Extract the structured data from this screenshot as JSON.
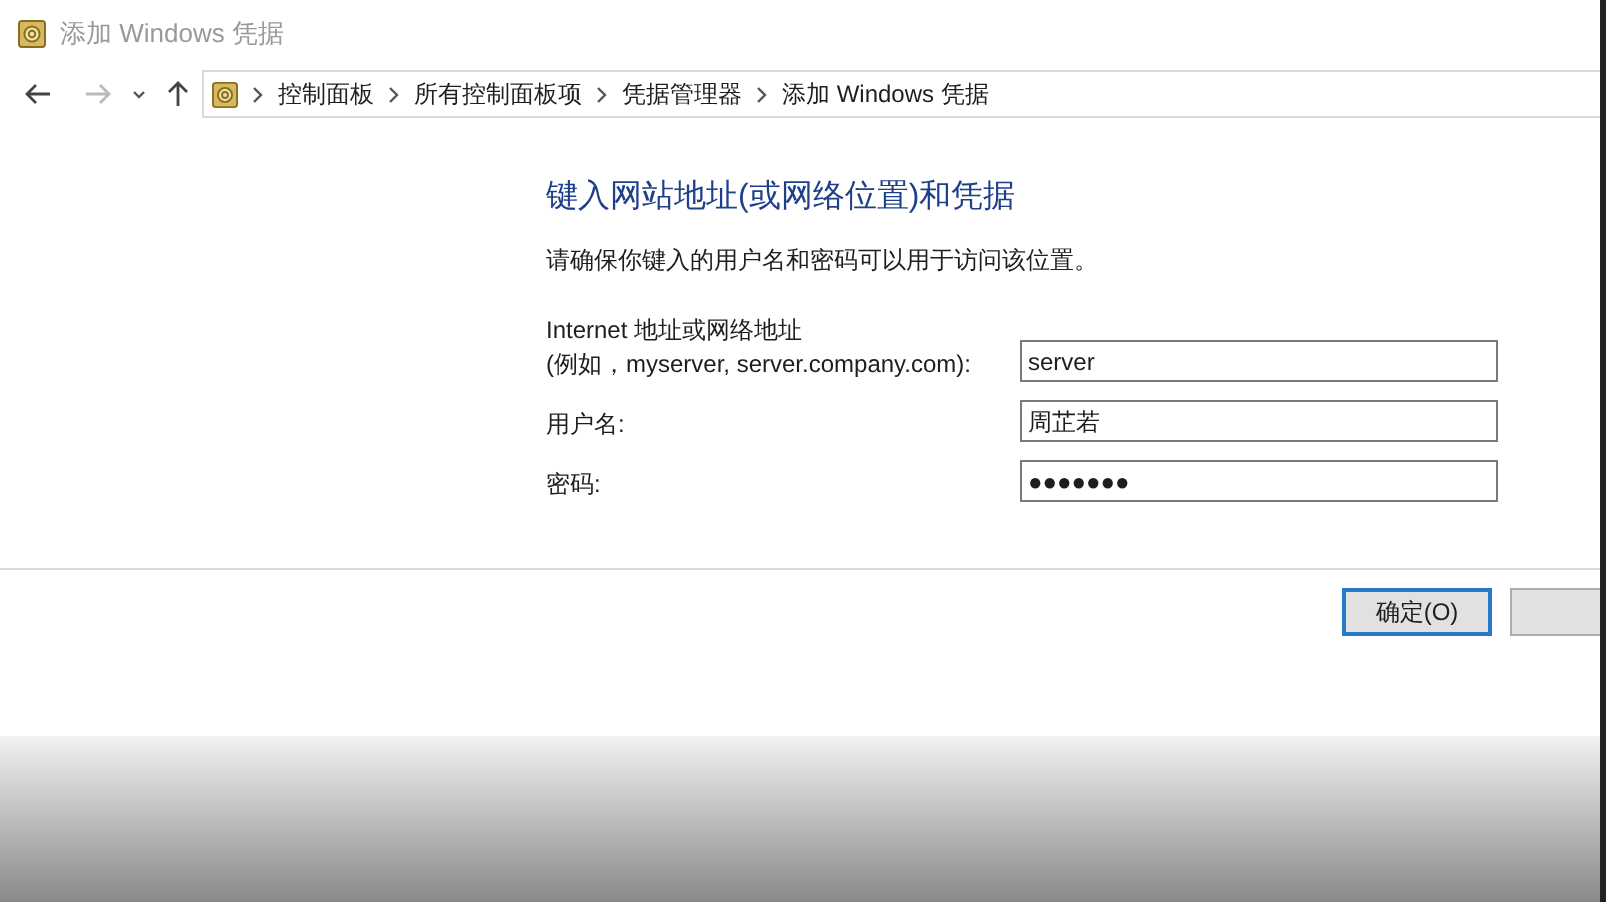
{
  "window": {
    "title": "添加 Windows 凭据"
  },
  "breadcrumb": [
    "控制面板",
    "所有控制面板项",
    "凭据管理器",
    "添加 Windows 凭据"
  ],
  "heading": "键入网站地址(或网络位置)和凭据",
  "description": "请确保你键入的用户名和密码可以用于访问该位置。",
  "fields": [
    {
      "label_lines": [
        "Internet 地址或网络地址",
        "(例如，myserver, server.company.com):"
      ],
      "value": "server"
    },
    {
      "label_lines": [
        "用户名:"
      ],
      "value": "周芷若"
    },
    {
      "label_lines": [
        "密码:"
      ],
      "value": "●●●●●●●"
    }
  ],
  "buttons": [
    {
      "label": "确定(O)",
      "selected": true
    },
    {
      "selected": false
    }
  ]
}
